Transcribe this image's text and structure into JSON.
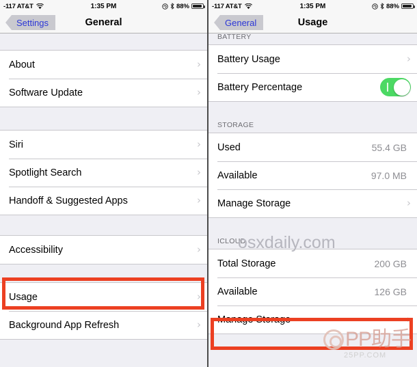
{
  "status_bar": {
    "carrier": "-117 AT&T",
    "wifi_icon": "wifi-icon",
    "time": "1:35 PM",
    "rotation_lock_icon": "rotation-lock-icon",
    "bluetooth_icon": "bluetooth-icon",
    "battery_percent": "88%",
    "battery_icon": "battery-icon"
  },
  "colors": {
    "accent_blue": "#2b36d6",
    "highlight_red": "#ec4022",
    "toggle_green": "#4cd964",
    "value_gray": "#8e8e93",
    "group_bg": "#ffffff",
    "page_bg": "#efeff4"
  },
  "left_panel": {
    "nav": {
      "back_label": "Settings",
      "title": "General",
      "back_icon": "back-chevron-icon"
    },
    "groups": [
      {
        "header": "",
        "rows": [
          {
            "label": "About",
            "value": "",
            "accessory": "chevron"
          },
          {
            "label": "Software Update",
            "value": "",
            "accessory": "chevron"
          }
        ]
      },
      {
        "header": "",
        "rows": [
          {
            "label": "Siri",
            "value": "",
            "accessory": "chevron"
          },
          {
            "label": "Spotlight Search",
            "value": "",
            "accessory": "chevron"
          },
          {
            "label": "Handoff & Suggested Apps",
            "value": "",
            "accessory": "chevron"
          }
        ]
      },
      {
        "header": "",
        "rows": [
          {
            "label": "Accessibility",
            "value": "",
            "accessory": "chevron"
          }
        ]
      },
      {
        "header": "",
        "rows": [
          {
            "label": "Usage",
            "value": "",
            "accessory": "chevron",
            "highlighted": true
          },
          {
            "label": "Background App Refresh",
            "value": "",
            "accessory": "chevron"
          }
        ]
      }
    ]
  },
  "right_panel": {
    "nav": {
      "back_label": "General",
      "title": "Usage",
      "back_icon": "back-chevron-icon"
    },
    "sections": [
      {
        "header": "BATTERY",
        "rows": [
          {
            "label": "Battery Usage",
            "value": "",
            "accessory": "chevron"
          },
          {
            "label": "Battery Percentage",
            "value": "",
            "accessory": "toggle",
            "toggle_on": true
          }
        ]
      },
      {
        "header": "STORAGE",
        "rows": [
          {
            "label": "Used",
            "value": "55.4 GB",
            "accessory": "none"
          },
          {
            "label": "Available",
            "value": "97.0 MB",
            "accessory": "none"
          },
          {
            "label": "Manage Storage",
            "value": "",
            "accessory": "chevron"
          }
        ]
      },
      {
        "header": "ICLOUD",
        "rows": [
          {
            "label": "Total Storage",
            "value": "200 GB",
            "accessory": "none"
          },
          {
            "label": "Available",
            "value": "126 GB",
            "accessory": "none"
          },
          {
            "label": "Manage Storage",
            "value": "",
            "accessory": "chevron",
            "highlighted": true
          }
        ]
      }
    ]
  },
  "watermarks": {
    "osxdaily": "osxdaily.com",
    "pp_assistant": "PP助手",
    "pp_url": "25PP.COM"
  }
}
